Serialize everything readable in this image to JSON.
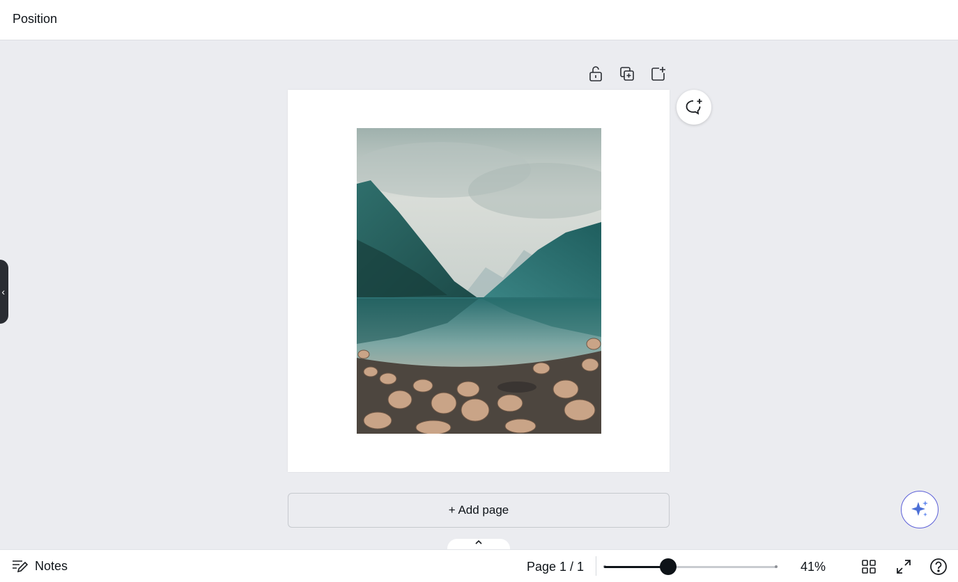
{
  "header": {
    "title": "Position"
  },
  "page_actions": {
    "lock_icon": "unlock-icon",
    "duplicate_icon": "duplicate-page-icon",
    "add_icon": "add-page-icon"
  },
  "canvas": {
    "image_description_icon": "landscape-photo",
    "add_page_label": "+ Add page",
    "comment_icon": "comment-add-icon",
    "magic_icon": "sparkle-icon"
  },
  "footer": {
    "notes_label": "Notes",
    "page_indicator": "Page 1 / 1",
    "zoom_percent_label": "41%",
    "zoom_value": 0.37,
    "grid_icon": "grid-view-icon",
    "fullscreen_icon": "fullscreen-icon",
    "help_icon": "help-icon"
  },
  "colors": {
    "canvas_bg": "#ebecf0",
    "accent": "#5b5fd8",
    "text": "#0e1318"
  }
}
